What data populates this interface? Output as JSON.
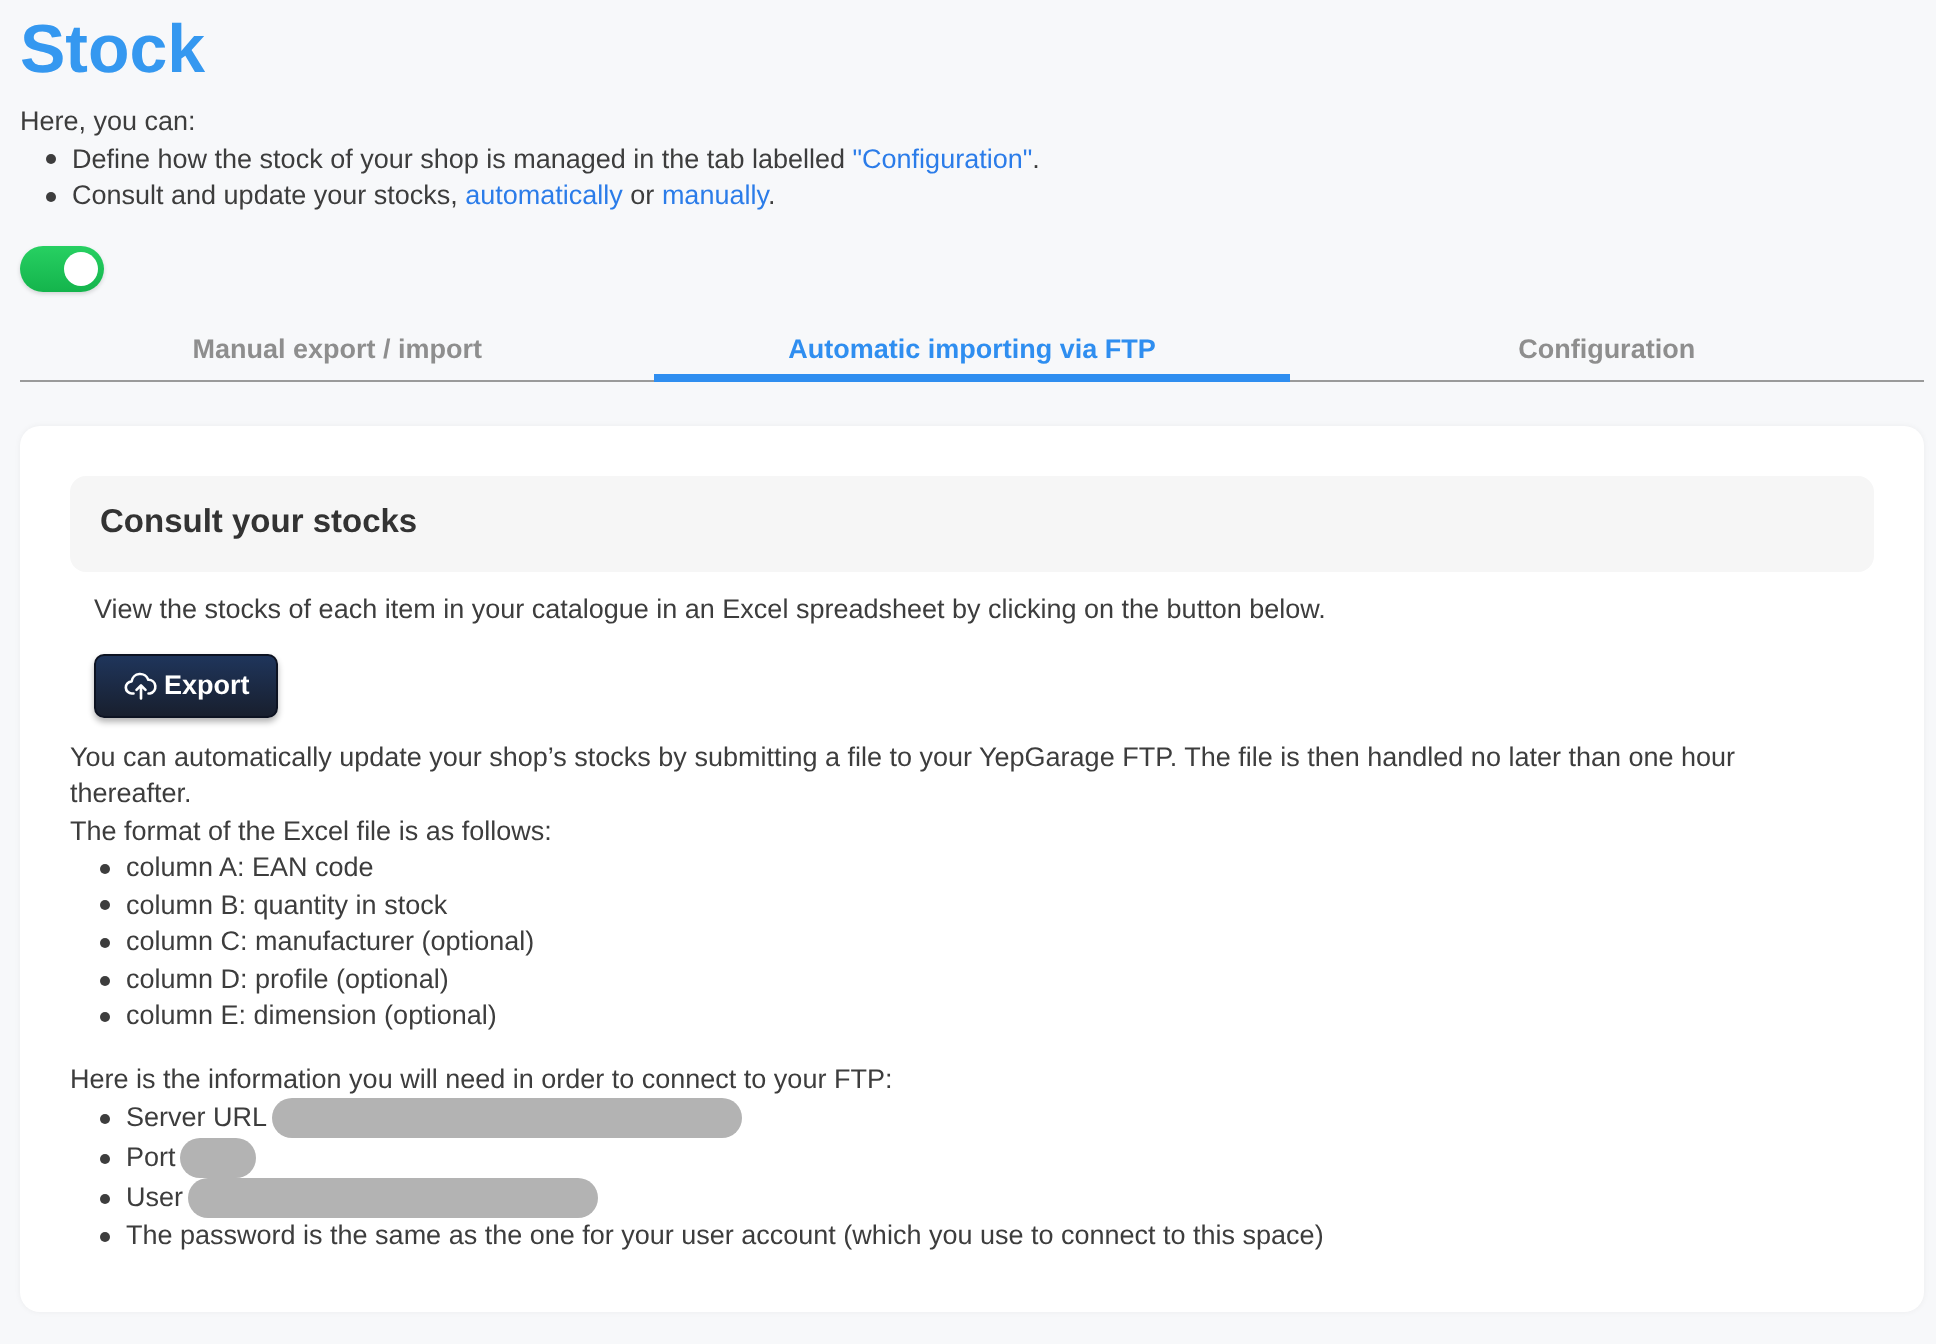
{
  "page": {
    "title": "Stock"
  },
  "intro": {
    "text": "Here, you can:",
    "items": [
      {
        "segments": [
          {
            "kind": "text",
            "text": "Define how the stock of your shop is managed in the tab labelled "
          },
          {
            "kind": "link",
            "text": "\"Configuration\""
          },
          {
            "kind": "text",
            "text": "."
          }
        ]
      },
      {
        "segments": [
          {
            "kind": "text",
            "text": "Consult and update your stocks, "
          },
          {
            "kind": "link",
            "text": "automatically"
          },
          {
            "kind": "text",
            "text": " or "
          },
          {
            "kind": "link",
            "text": "manually"
          },
          {
            "kind": "text",
            "text": "."
          }
        ]
      }
    ]
  },
  "toggle": {
    "on": true
  },
  "tabs": [
    {
      "label": "Manual export / import",
      "selected": false
    },
    {
      "label": "Automatic importing via FTP",
      "selected": true
    },
    {
      "label": "Configuration",
      "selected": false
    }
  ],
  "card": {
    "section_title": "Consult your stocks",
    "description": "View the stocks of each item in your catalogue in an Excel spreadsheet by clicking on the button below.",
    "export_button": {
      "label": "Export"
    },
    "import_text": "You can automatically update your shop’s stocks by submitting a file to your YepGarage FTP. The file is then handled no later than one hour thereafter.",
    "format_text": "The format of the Excel file is as follows:",
    "columns": [
      "column A: EAN code",
      "column B: quantity in stock",
      "column C: manufacturer (optional)",
      "column D: profile (optional)",
      "column E: dimension (optional)"
    ],
    "ftp_intro": "Here is the information you will need in order to connect to your FTP:",
    "ftp_items": [
      {
        "label": "Server URL",
        "redacted": true
      },
      {
        "label": "Port",
        "redacted": true
      },
      {
        "label": "User",
        "redacted": true
      },
      {
        "label": "The password is the same as the one for your user account (which you use to connect to this space)",
        "redacted": false
      }
    ]
  }
}
